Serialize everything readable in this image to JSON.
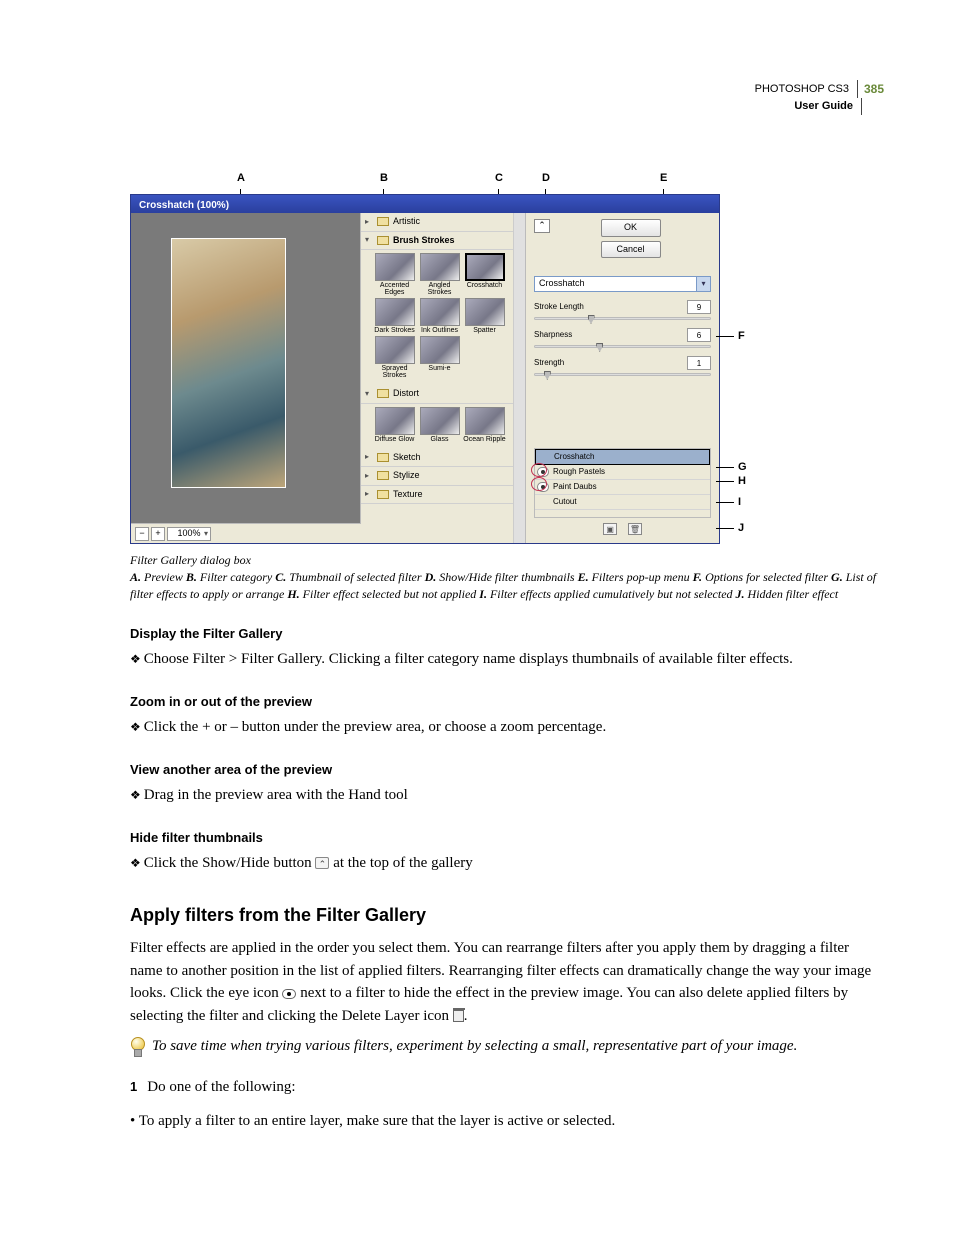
{
  "header": {
    "product": "PHOTOSHOP CS3",
    "subtitle": "User Guide",
    "page_number": "385"
  },
  "dialog": {
    "window_title": "Crosshatch (100%)",
    "zoom_value": "100%",
    "buttons": {
      "ok": "OK",
      "cancel": "Cancel"
    },
    "popup_selected": "Crosshatch",
    "params": [
      {
        "label": "Stroke Length",
        "value": "9",
        "pos": 30
      },
      {
        "label": "Sharpness",
        "value": "6",
        "pos": 35
      },
      {
        "label": "Strength",
        "value": "1",
        "pos": 5
      }
    ],
    "collapsed_categories": {
      "artistic": "Artistic",
      "sketch": "Sketch",
      "stylize": "Stylize",
      "texture": "Texture"
    },
    "open_categories": {
      "brush_strokes": "Brush Strokes",
      "distort": "Distort"
    },
    "brush_thumbs": [
      "Accented Edges",
      "Angled Strokes",
      "Crosshatch",
      "Dark Strokes",
      "Ink Outlines",
      "Spatter",
      "Sprayed Strokes",
      "Sumi-e"
    ],
    "distort_thumbs": [
      "Diffuse Glow",
      "Glass",
      "Ocean Ripple"
    ],
    "applied_effects": [
      {
        "name": "Crosshatch",
        "selected": true,
        "eye": false
      },
      {
        "name": "Rough Pastels",
        "selected": false,
        "eye": true
      },
      {
        "name": "Paint Daubs",
        "selected": false,
        "eye": true
      },
      {
        "name": "Cutout",
        "selected": false,
        "eye": false
      }
    ]
  },
  "callout_letters": {
    "A": "A",
    "B": "B",
    "C": "C",
    "D": "D",
    "E": "E",
    "F": "F",
    "G": "G",
    "H": "H",
    "I": "I",
    "J": "J"
  },
  "caption_title": "Filter Gallery dialog box",
  "caption_items": [
    {
      "letter": "A.",
      "text": "Preview"
    },
    {
      "letter": "B.",
      "text": "Filter category"
    },
    {
      "letter": "C.",
      "text": "Thumbnail of selected filter"
    },
    {
      "letter": "D.",
      "text": "Show/Hide filter thumbnails"
    },
    {
      "letter": "E.",
      "text": "Filters pop-up menu"
    },
    {
      "letter": "F.",
      "text": "Options for selected filter"
    },
    {
      "letter": "G.",
      "text": "List of filter effects to apply or arrange"
    },
    {
      "letter": "H.",
      "text": "Filter effect selected but not applied"
    },
    {
      "letter": "I.",
      "text": "Filter effects applied cumulatively but not selected"
    },
    {
      "letter": "J.",
      "text": "Hidden filter effect"
    }
  ],
  "sections": [
    {
      "heading": "Display the Filter Gallery",
      "step_text": "Choose Filter > Filter Gallery. Clicking a filter category name displays thumbnails of available filter effects."
    },
    {
      "heading": "Zoom in or out of the preview",
      "step_text": "Click the + or – button under the preview area, or choose a zoom percentage."
    },
    {
      "heading": "View another area of the preview",
      "step_text": "Drag in the preview area with the Hand tool"
    },
    {
      "heading": "Hide filter thumbnails",
      "step_pre": "Click the Show/Hide button ",
      "step_post": " at the top of the gallery"
    }
  ],
  "apply_section": {
    "heading": "Apply filters from the Filter Gallery",
    "para_pre": "Filter effects are applied in the order you select them. You can rearrange filters after you apply them by dragging a filter name to another position in the list of applied filters. Rearranging filter effects can dramatically change the way your image looks. Click the eye icon ",
    "para_mid": " next to a filter to hide the effect in the preview image. You can also delete applied filters by selecting the filter and clicking the Delete Layer icon ",
    "para_post": ".",
    "tip": "To save time when trying various filters, experiment by selecting a small, representative part of your image.",
    "step1": "Do one of the following:",
    "bullet1": "To apply a filter to an entire layer, make sure that the layer is active or selected."
  }
}
